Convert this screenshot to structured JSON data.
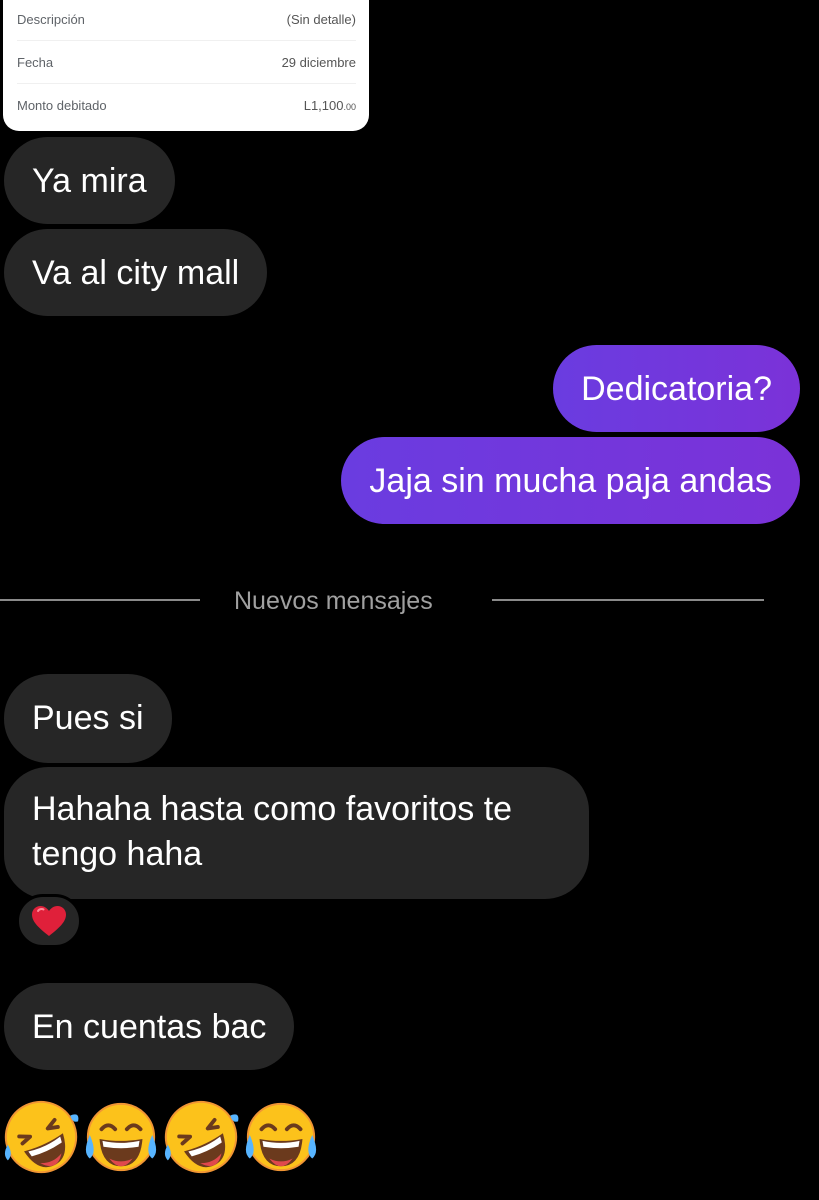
{
  "receipt": {
    "rows": [
      {
        "label": "Descripción",
        "value": "(Sin detalle)"
      },
      {
        "label": "Fecha",
        "value": "29 diciembre"
      },
      {
        "label": "Monto debitado",
        "value_main": "L1,100",
        "value_cents": ".00"
      }
    ]
  },
  "messages": {
    "in_1": "Ya mira",
    "in_2": "Va al city mall",
    "out_1": "Dedicatoria?",
    "out_2": "Jaja sin mucha paja andas",
    "divider_label": "Nuevos mensajes",
    "in_3": "Pues si",
    "in_4": "Hahaha hasta como favoritos te tengo haha",
    "in_5": "En cuentas bac"
  },
  "reaction": {
    "icon": "red-heart-icon",
    "color": "#e0203a"
  },
  "emoji_row": [
    "rolling-on-floor-laughing-icon",
    "tears-of-joy-icon",
    "rolling-on-floor-laughing-icon",
    "tears-of-joy-icon"
  ],
  "colors": {
    "background": "#000000",
    "incoming_bubble": "#262626",
    "outgoing_bubble_start": "#6a3ce0",
    "outgoing_bubble_end": "#7b32d8"
  }
}
